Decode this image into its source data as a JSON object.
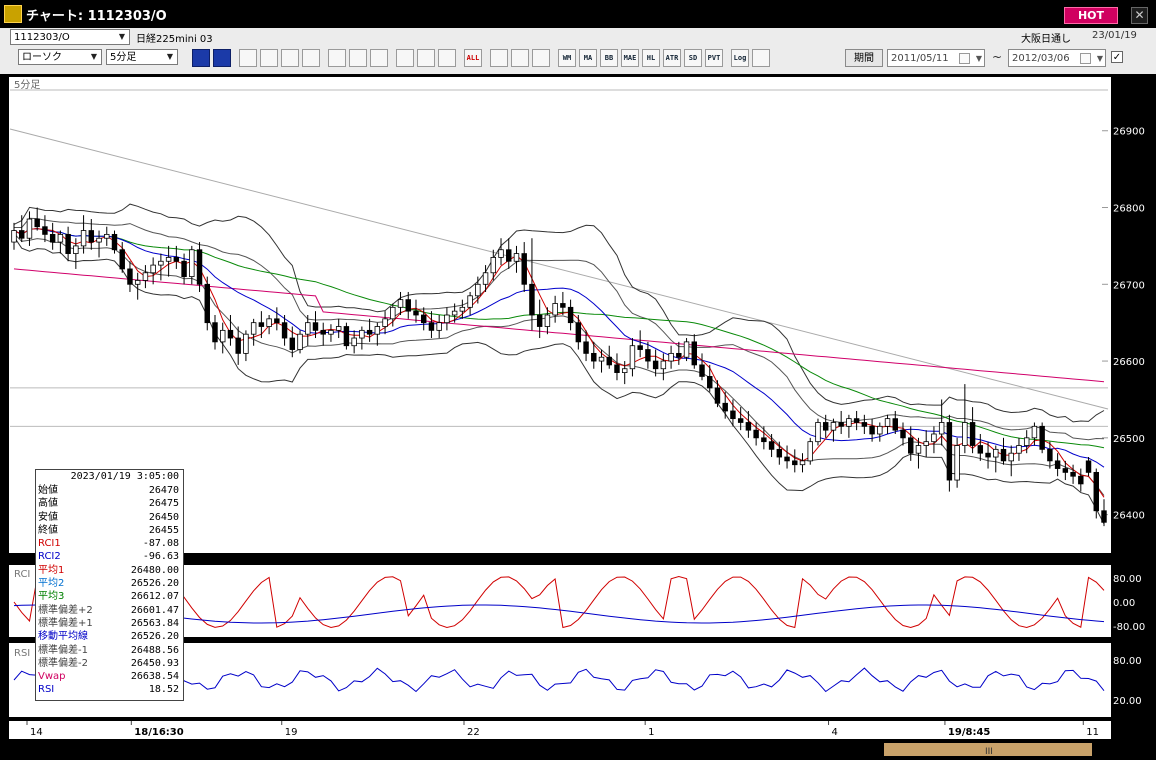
{
  "window": {
    "title": "チャート: 1112303/O",
    "hot_label": "HOT",
    "close_label": "✕"
  },
  "toolbar": {
    "symbol_code": "1112303/O",
    "symbol_name": "日経225mini 03",
    "exchange": "大阪日通し",
    "date": "23/01/19",
    "chart_type": "ローソク",
    "interval": "5分足",
    "period_button": "期間",
    "date_from": "2011/05/11",
    "date_to": "2012/03/06",
    "range_separator": "~",
    "checkbox_mark": "✓",
    "buttons": [
      "zoom-in",
      "zoom-out",
      "arrow-down",
      "radar",
      "bar-chart",
      "split",
      "alert",
      "pen",
      "cursor",
      "undo",
      "draw-a",
      "draw-b",
      "ALL",
      "settings",
      "wrench",
      "palette",
      "WM",
      "MA",
      "BB",
      "MAE",
      "HL",
      "ATR",
      "SD",
      "PVT",
      "Log",
      "export"
    ]
  },
  "chart_data": {
    "type": "candlestick",
    "main_label": "5分足",
    "y_ticks": [
      26900,
      26800,
      26700,
      26600,
      26500,
      26400
    ],
    "x_ticks": [
      {
        "pos": 0.0,
        "label": "14",
        "bold": false
      },
      {
        "pos": 0.095,
        "label": "18/16:30",
        "bold": true
      },
      {
        "pos": 0.232,
        "label": "19",
        "bold": false
      },
      {
        "pos": 0.398,
        "label": "22",
        "bold": false
      },
      {
        "pos": 0.563,
        "label": "1",
        "bold": false
      },
      {
        "pos": 0.73,
        "label": "4",
        "bold": false
      },
      {
        "pos": 0.836,
        "label": "19/8:45",
        "bold": true
      },
      {
        "pos": 0.962,
        "label": "11",
        "bold": false
      }
    ],
    "candles": [
      [
        26755,
        26780,
        26745,
        26770
      ],
      [
        26770,
        26790,
        26755,
        26760
      ],
      [
        26760,
        26795,
        26750,
        26785
      ],
      [
        26785,
        26800,
        26770,
        26775
      ],
      [
        26775,
        26790,
        26755,
        26765
      ],
      [
        26765,
        26780,
        26745,
        26755
      ],
      [
        26755,
        26770,
        26740,
        26765
      ],
      [
        26765,
        26775,
        26730,
        26740
      ],
      [
        26740,
        26760,
        26720,
        26750
      ],
      [
        26750,
        26790,
        26740,
        26770
      ],
      [
        26770,
        26785,
        26745,
        26755
      ],
      [
        26755,
        26770,
        26735,
        26760
      ],
      [
        26760,
        26775,
        26750,
        26765
      ],
      [
        26765,
        26770,
        26740,
        26745
      ],
      [
        26745,
        26755,
        26715,
        26720
      ],
      [
        26720,
        26730,
        26690,
        26700
      ],
      [
        26700,
        26715,
        26680,
        26705
      ],
      [
        26705,
        26725,
        26695,
        26715
      ],
      [
        26715,
        26735,
        26700,
        26725
      ],
      [
        26725,
        26740,
        26705,
        26730
      ],
      [
        26730,
        26750,
        26710,
        26735
      ],
      [
        26735,
        26750,
        26720,
        26730
      ],
      [
        26730,
        26740,
        26700,
        26710
      ],
      [
        26710,
        26750,
        26700,
        26745
      ],
      [
        26745,
        26755,
        26690,
        26700
      ],
      [
        26700,
        26710,
        26640,
        26650
      ],
      [
        26650,
        26660,
        26615,
        26625
      ],
      [
        26625,
        26650,
        26610,
        26640
      ],
      [
        26640,
        26660,
        26620,
        26630
      ],
      [
        26630,
        26645,
        26595,
        26610
      ],
      [
        26610,
        26640,
        26600,
        26635
      ],
      [
        26635,
        26655,
        26620,
        26650
      ],
      [
        26650,
        26665,
        26630,
        26645
      ],
      [
        26645,
        26660,
        26635,
        26655
      ],
      [
        26655,
        26670,
        26640,
        26650
      ],
      [
        26650,
        26660,
        26620,
        26630
      ],
      [
        26630,
        26645,
        26605,
        26615
      ],
      [
        26615,
        26640,
        26610,
        26635
      ],
      [
        26635,
        26660,
        26620,
        26650
      ],
      [
        26650,
        26665,
        26630,
        26640
      ],
      [
        26640,
        26650,
        26620,
        26635
      ],
      [
        26635,
        26648,
        26625,
        26640
      ],
      [
        26640,
        26655,
        26630,
        26645
      ],
      [
        26645,
        26650,
        26615,
        26620
      ],
      [
        26620,
        26640,
        26610,
        26630
      ],
      [
        26630,
        26645,
        26615,
        26640
      ],
      [
        26640,
        26655,
        26625,
        26635
      ],
      [
        26635,
        26650,
        26620,
        26645
      ],
      [
        26645,
        26665,
        26635,
        26655
      ],
      [
        26655,
        26675,
        26645,
        26670
      ],
      [
        26670,
        26690,
        26660,
        26680
      ],
      [
        26680,
        26690,
        26655,
        26665
      ],
      [
        26665,
        26680,
        26650,
        26660
      ],
      [
        26660,
        26670,
        26640,
        26650
      ],
      [
        26650,
        26665,
        26630,
        26640
      ],
      [
        26640,
        26660,
        26630,
        26650
      ],
      [
        26650,
        26670,
        26640,
        26660
      ],
      [
        26660,
        26675,
        26650,
        26665
      ],
      [
        26665,
        26680,
        26655,
        26670
      ],
      [
        26670,
        26690,
        26660,
        26685
      ],
      [
        26685,
        26710,
        26675,
        26700
      ],
      [
        26700,
        26725,
        26690,
        26715
      ],
      [
        26715,
        26745,
        26705,
        26735
      ],
      [
        26735,
        26760,
        26725,
        26745
      ],
      [
        26745,
        26760,
        26720,
        26730
      ],
      [
        26730,
        26750,
        26715,
        26740
      ],
      [
        26740,
        26755,
        26690,
        26700
      ],
      [
        26700,
        26760,
        26640,
        26660
      ],
      [
        26660,
        26680,
        26630,
        26645
      ],
      [
        26645,
        26670,
        26635,
        26660
      ],
      [
        26660,
        26685,
        26650,
        26675
      ],
      [
        26675,
        26690,
        26660,
        26670
      ],
      [
        26670,
        26680,
        26640,
        26650
      ],
      [
        26650,
        26660,
        26615,
        26625
      ],
      [
        26625,
        26640,
        26600,
        26610
      ],
      [
        26610,
        26625,
        26590,
        26600
      ],
      [
        26600,
        26615,
        26585,
        26605
      ],
      [
        26605,
        26620,
        26590,
        26595
      ],
      [
        26595,
        26610,
        26575,
        26585
      ],
      [
        26585,
        26600,
        26570,
        26590
      ],
      [
        26590,
        26630,
        26580,
        26620
      ],
      [
        26620,
        26640,
        26605,
        26615
      ],
      [
        26615,
        26625,
        26590,
        26600
      ],
      [
        26600,
        26615,
        26580,
        26590
      ],
      [
        26590,
        26610,
        26575,
        26600
      ],
      [
        26600,
        26620,
        26590,
        26610
      ],
      [
        26610,
        26625,
        26595,
        26605
      ],
      [
        26605,
        26630,
        26600,
        26625
      ],
      [
        26625,
        26635,
        26590,
        26595
      ],
      [
        26595,
        26610,
        26575,
        26580
      ],
      [
        26580,
        26595,
        26560,
        26565
      ],
      [
        26565,
        26575,
        26540,
        26545
      ],
      [
        26545,
        26560,
        26525,
        26535
      ],
      [
        26535,
        26550,
        26515,
        26525
      ],
      [
        26525,
        26540,
        26510,
        26520
      ],
      [
        26520,
        26535,
        26500,
        26510
      ],
      [
        26510,
        26520,
        26490,
        26500
      ],
      [
        26500,
        26515,
        26485,
        26495
      ],
      [
        26495,
        26505,
        26475,
        26485
      ],
      [
        26485,
        26495,
        26465,
        26475
      ],
      [
        26475,
        26490,
        26460,
        26470
      ],
      [
        26470,
        26485,
        26455,
        26465
      ],
      [
        26465,
        26480,
        26455,
        26470
      ],
      [
        26470,
        26500,
        26465,
        26495
      ],
      [
        26495,
        26525,
        26490,
        26520
      ],
      [
        26520,
        26530,
        26500,
        26510
      ],
      [
        26510,
        26525,
        26495,
        26520
      ],
      [
        26520,
        26535,
        26505,
        26515
      ],
      [
        26515,
        26530,
        26500,
        26525
      ],
      [
        26525,
        26535,
        26510,
        26520
      ],
      [
        26520,
        26530,
        26505,
        26515
      ],
      [
        26515,
        26525,
        26495,
        26505
      ],
      [
        26505,
        26520,
        26495,
        26515
      ],
      [
        26515,
        26530,
        26505,
        26525
      ],
      [
        26525,
        26535,
        26505,
        26510
      ],
      [
        26510,
        26520,
        26490,
        26500
      ],
      [
        26500,
        26515,
        26470,
        26480
      ],
      [
        26480,
        26500,
        26460,
        26490
      ],
      [
        26490,
        26510,
        26475,
        26495
      ],
      [
        26495,
        26515,
        26480,
        26505
      ],
      [
        26505,
        26550,
        26490,
        26520
      ],
      [
        26520,
        26530,
        26430,
        26445
      ],
      [
        26445,
        26500,
        26435,
        26490
      ],
      [
        26490,
        26570,
        26480,
        26520
      ],
      [
        26520,
        26540,
        26480,
        26490
      ],
      [
        26490,
        26505,
        26470,
        26480
      ],
      [
        26480,
        26495,
        26460,
        26475
      ],
      [
        26475,
        26490,
        26455,
        26485
      ],
      [
        26485,
        26500,
        26465,
        26470
      ],
      [
        26470,
        26490,
        26450,
        26480
      ],
      [
        26480,
        26500,
        26470,
        26490
      ],
      [
        26490,
        26510,
        26480,
        26500
      ],
      [
        26500,
        26520,
        26490,
        26515
      ],
      [
        26515,
        26520,
        26480,
        26485
      ],
      [
        26485,
        26495,
        26460,
        26470
      ],
      [
        26470,
        26480,
        26450,
        26460
      ],
      [
        26460,
        26470,
        26445,
        26455
      ],
      [
        26455,
        26465,
        26440,
        26450
      ],
      [
        26450,
        26460,
        26430,
        26440
      ],
      [
        26470,
        26475,
        26450,
        26455
      ],
      [
        26455,
        26460,
        26395,
        26405
      ],
      [
        26405,
        26420,
        26385,
        26390
      ]
    ],
    "rci_panel": {
      "label": "RCI",
      "y_ticks": [
        "80.00",
        "0.00",
        "-80.00"
      ]
    },
    "rsi_panel": {
      "label": "RSI",
      "y_ticks": [
        "80.00",
        "20.00"
      ]
    }
  },
  "info_panel": {
    "timestamp": "2023/01/19 3:05:00",
    "rows": [
      {
        "label": "始値",
        "value": "26470",
        "color": "#000000"
      },
      {
        "label": "高値",
        "value": "26475",
        "color": "#000000"
      },
      {
        "label": "安値",
        "value": "26450",
        "color": "#000000"
      },
      {
        "label": "終値",
        "value": "26455",
        "color": "#000000"
      },
      {
        "label": "RCI1",
        "value": "-87.08",
        "color": "#d00000"
      },
      {
        "label": "RCI2",
        "value": "-96.63",
        "color": "#0000c8"
      },
      {
        "label": "平均1",
        "value": "26480.00",
        "color": "#d00000"
      },
      {
        "label": "平均2",
        "value": "26526.20",
        "color": "#0070d0"
      },
      {
        "label": "平均3",
        "value": "26612.07",
        "color": "#008000"
      },
      {
        "label": "標準偏差+2",
        "value": "26601.47",
        "color": "#444444"
      },
      {
        "label": "標準偏差+1",
        "value": "26563.84",
        "color": "#444444"
      },
      {
        "label": "移動平均線",
        "value": "26526.20",
        "color": "#0000c8"
      },
      {
        "label": "標準偏差-1",
        "value": "26488.56",
        "color": "#444444"
      },
      {
        "label": "標準偏差-2",
        "value": "26450.93",
        "color": "#444444"
      },
      {
        "label": "Vwap",
        "value": "26638.54",
        "color": "#d00060"
      },
      {
        "label": "RSI",
        "value": "18.52",
        "color": "#0000c8"
      }
    ]
  }
}
